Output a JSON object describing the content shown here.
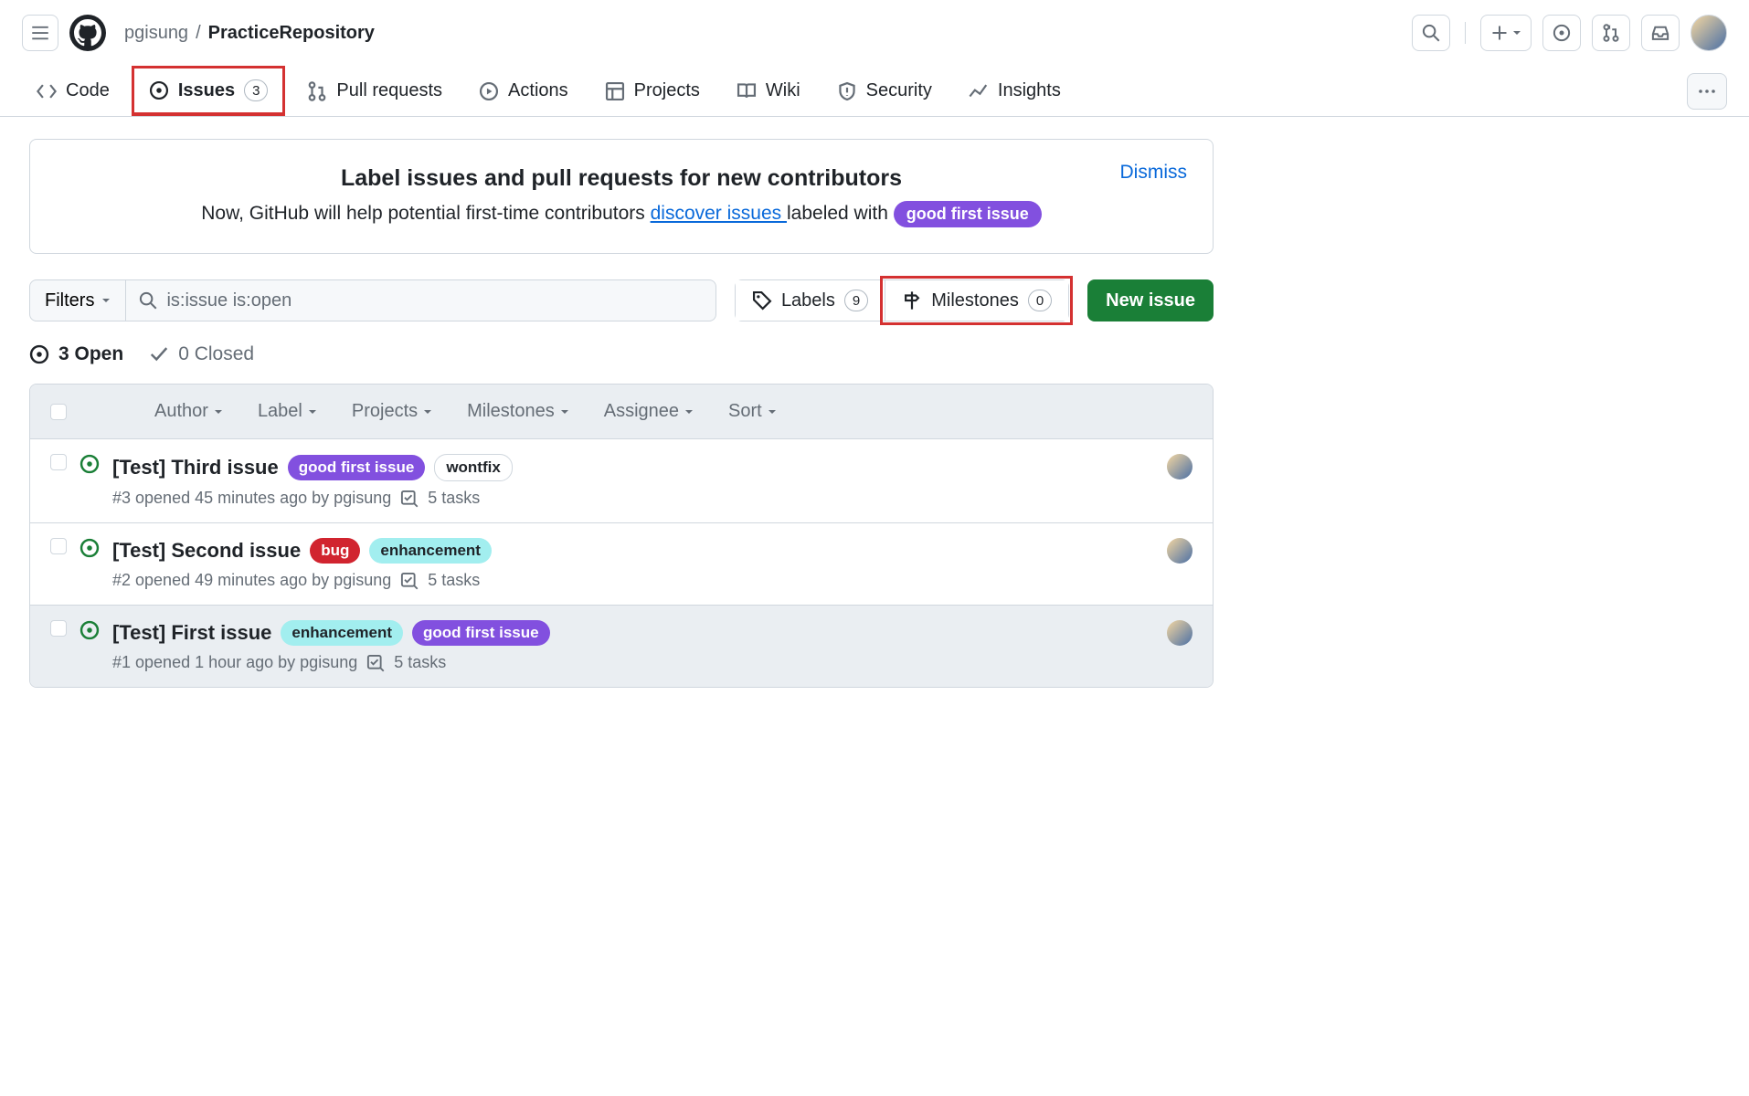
{
  "breadcrumb": {
    "owner": "pgisung",
    "repo": "PracticeRepository"
  },
  "nav": {
    "code": "Code",
    "issues": "Issues",
    "issues_count": "3",
    "pulls": "Pull requests",
    "actions": "Actions",
    "projects": "Projects",
    "wiki": "Wiki",
    "security": "Security",
    "insights": "Insights"
  },
  "banner": {
    "title": "Label issues and pull requests for new contributors",
    "text_before": "Now, GitHub will help potential first-time contributors ",
    "link": "discover issues ",
    "text_after": "labeled with ",
    "pill": "good first issue",
    "dismiss": "Dismiss"
  },
  "filters": {
    "button": "Filters",
    "query": "is:issue is:open",
    "labels": "Labels",
    "labels_count": "9",
    "milestones": "Milestones",
    "milestones_count": "0",
    "new_issue": "New issue"
  },
  "status": {
    "open": "3 Open",
    "closed": "0 Closed"
  },
  "table": {
    "headers": {
      "author": "Author",
      "label": "Label",
      "projects": "Projects",
      "milestones": "Milestones",
      "assignee": "Assignee",
      "sort": "Sort"
    }
  },
  "issues": [
    {
      "title": "[Test] Third issue",
      "labels": [
        {
          "text": "good first issue",
          "cls": "label-purple"
        },
        {
          "text": "wontfix",
          "cls": "label-outline"
        }
      ],
      "meta": "#3 opened 45 minutes ago by pgisung",
      "tasks": "5 tasks",
      "selected": false
    },
    {
      "title": "[Test] Second issue",
      "labels": [
        {
          "text": "bug",
          "cls": "label-red"
        },
        {
          "text": "enhancement",
          "cls": "label-teal"
        }
      ],
      "meta": "#2 opened 49 minutes ago by pgisung",
      "tasks": "5 tasks",
      "selected": false
    },
    {
      "title": "[Test] First issue",
      "labels": [
        {
          "text": "enhancement",
          "cls": "label-teal"
        },
        {
          "text": "good first issue",
          "cls": "label-purple"
        }
      ],
      "meta": "#1 opened 1 hour ago by pgisung",
      "tasks": "5 tasks",
      "selected": true
    }
  ]
}
